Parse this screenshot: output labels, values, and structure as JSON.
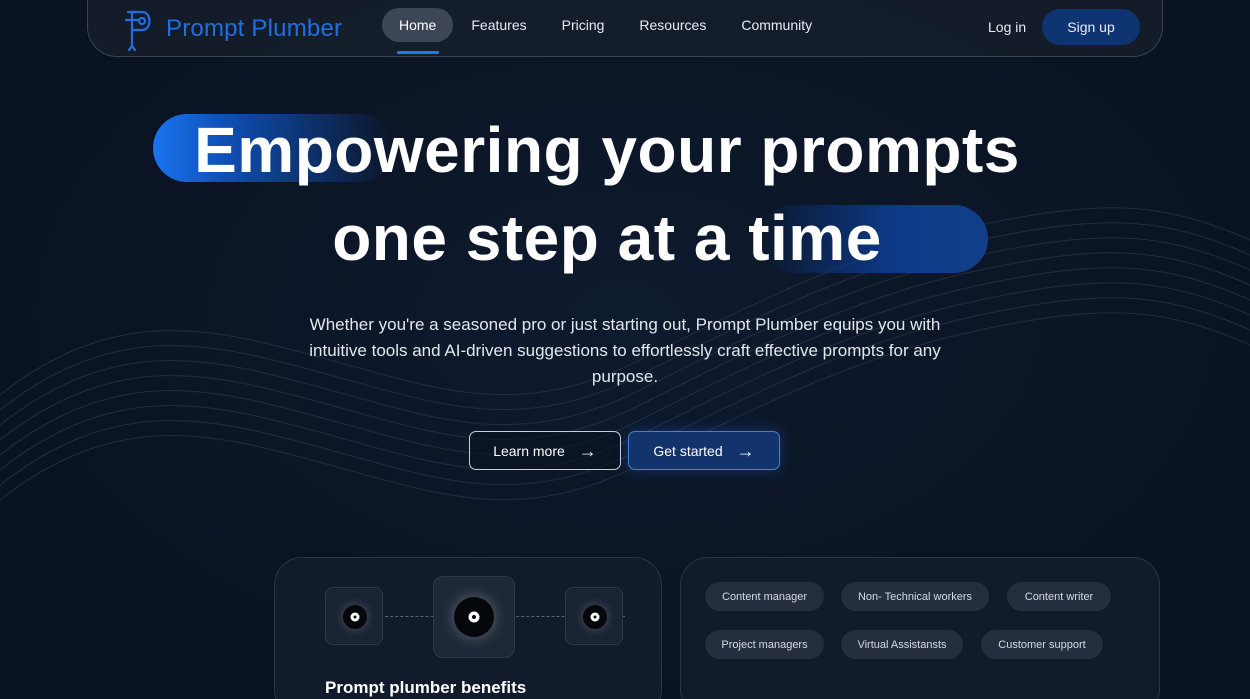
{
  "brand": {
    "name": "Prompt Plumber",
    "color": "#1f6fe0",
    "logo_icon": "p-pipe-logo-icon"
  },
  "nav": {
    "links": [
      {
        "label": "Home",
        "active": true
      },
      {
        "label": "Features",
        "active": false
      },
      {
        "label": "Pricing",
        "active": false
      },
      {
        "label": "Resources",
        "active": false
      },
      {
        "label": "Community",
        "active": false
      }
    ],
    "login_label": "Log in",
    "signup_label": "Sign up"
  },
  "hero": {
    "title_line1": "Empowering your prompts",
    "title_line2": "one step at a time",
    "subtitle": "Whether you're a seasoned pro or just starting out, Prompt Plumber equips you with intuitive tools and AI-driven suggestions to effortlessly craft effective prompts for any purpose.",
    "learn_more_label": "Learn more",
    "get_started_label": "Get started",
    "accent_color": "#1a74f0"
  },
  "benefits_card": {
    "title": "Prompt plumber benefits"
  },
  "audience_card": {
    "chips": [
      "Content manager",
      "Non- Technical workers",
      "Content writer",
      "Project managers",
      "Virtual Assistansts",
      "Customer support"
    ]
  }
}
